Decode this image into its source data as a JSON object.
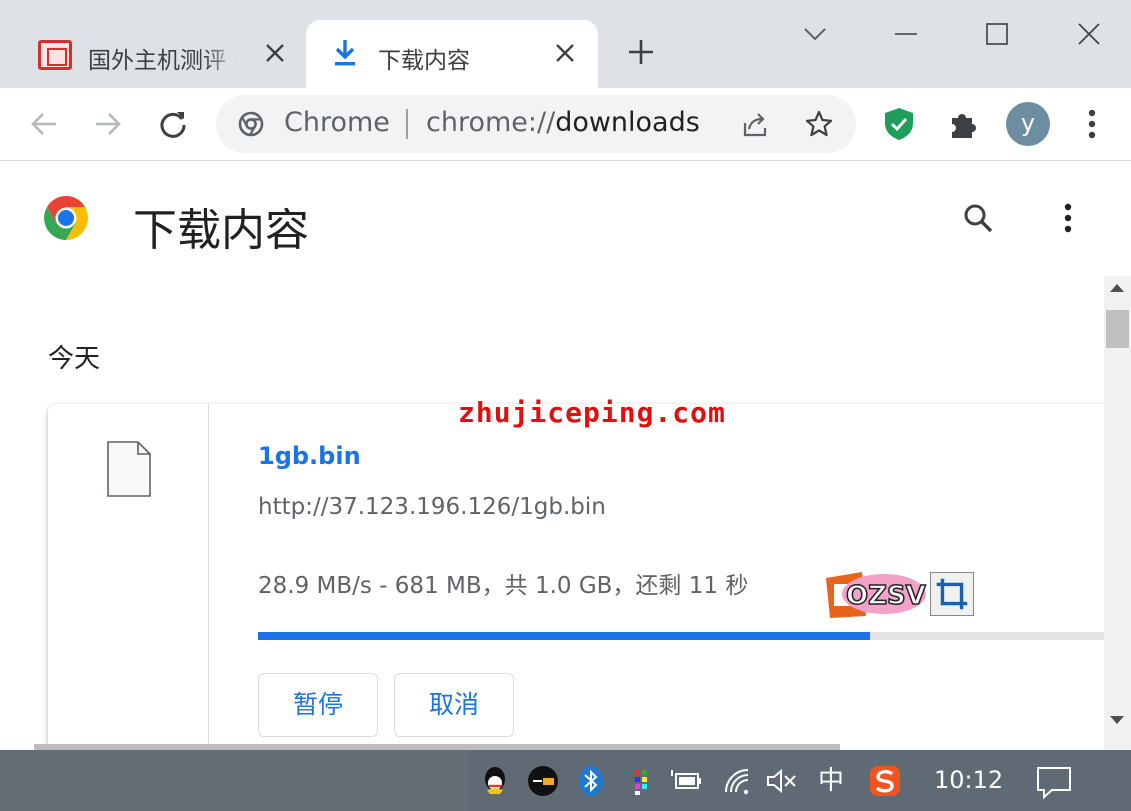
{
  "tabs": [
    {
      "title": "国外主机测评 - ",
      "active": false
    },
    {
      "title": "下载内容",
      "active": true
    }
  ],
  "omnibox": {
    "chip": "Chrome",
    "url_scheme": "chrome://",
    "url_host": "downloads"
  },
  "profile": {
    "initial": "y"
  },
  "page": {
    "title": "下载内容",
    "date_header": "今天"
  },
  "download": {
    "file_name": "1gb.bin",
    "url": "http://37.123.196.126/1gb.bin",
    "status": "28.9 MB/s - 681 MB，共 1.0 GB，还剩 11 秒",
    "progress": 0.68,
    "pause_label": "暂停",
    "cancel_label": "取消"
  },
  "watermark": "zhujiceping.com",
  "taskbar": {
    "clock": "10:12",
    "ime": "中",
    "tray_icons": [
      "qq-icon",
      "app-icon",
      "bluetooth-icon",
      "color-app-icon",
      "battery-icon",
      "wifi-icon",
      "volume-muted-icon",
      "ime-icon",
      "sogou-icon"
    ]
  },
  "colors": {
    "accent": "#1a73e8",
    "watermark": "#e01010",
    "tabstrip": "#dee1e6",
    "taskbar": "#5f6a74"
  }
}
